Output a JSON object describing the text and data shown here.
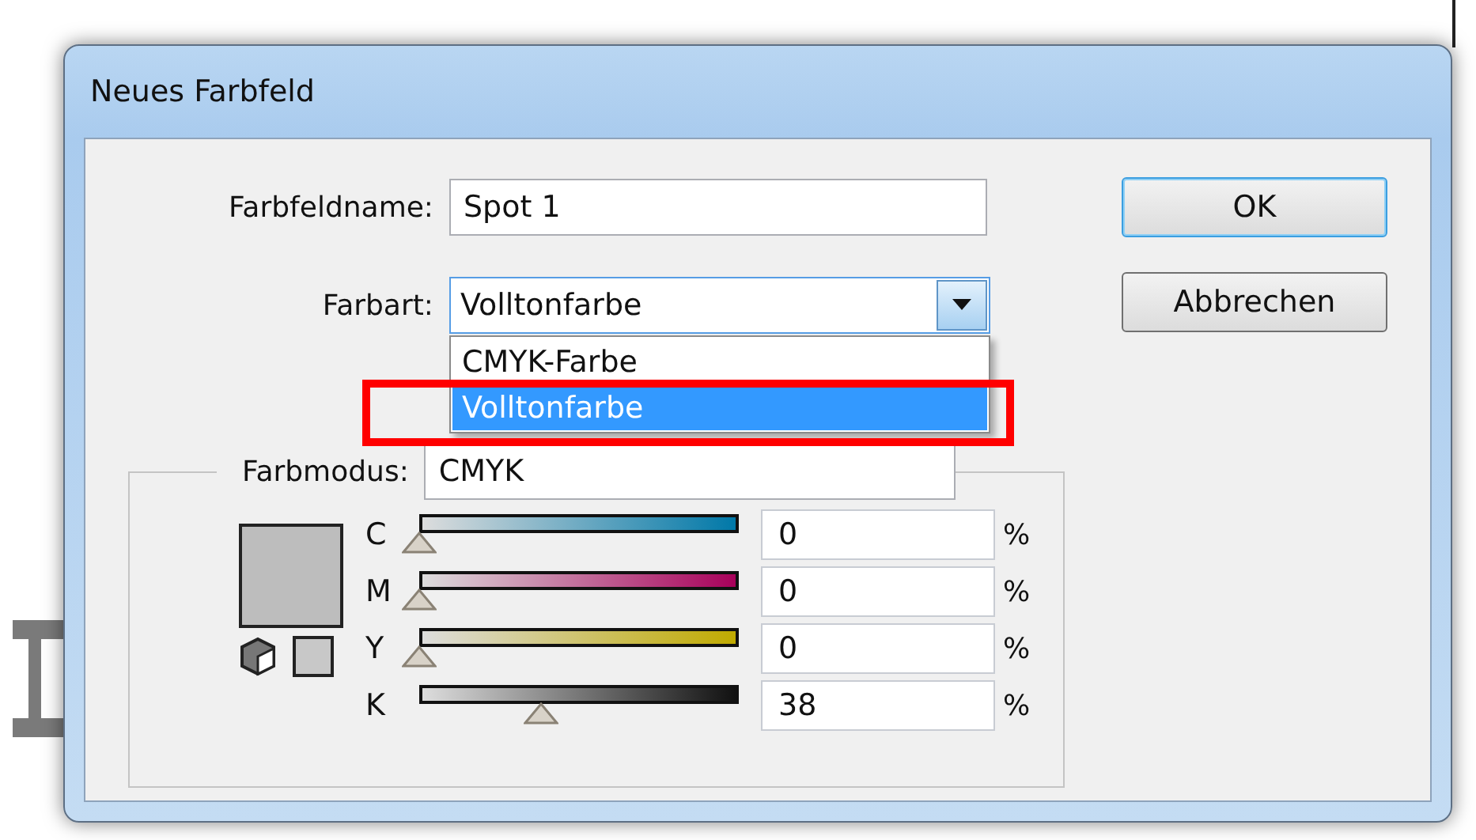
{
  "window": {
    "title": "Neues Farbfeld"
  },
  "name_field": {
    "label": "Farbfeldname:",
    "value": "Spot 1"
  },
  "color_type": {
    "label": "Farbart:",
    "value": "Volltonfarbe",
    "expanded": true,
    "options": [
      {
        "label": "CMYK-Farbe",
        "selected": false
      },
      {
        "label": "Volltonfarbe",
        "selected": true
      }
    ]
  },
  "color_mode": {
    "label": "Farbmodus:",
    "value": "CMYK"
  },
  "channels": [
    {
      "name": "C",
      "level": 0,
      "value": "0",
      "unit": "%",
      "color": "#0078a8"
    },
    {
      "name": "M",
      "level": 0,
      "value": "0",
      "unit": "%",
      "color": "#a8005a"
    },
    {
      "name": "Y",
      "level": 0,
      "value": "0",
      "unit": "%",
      "color": "#c0aa00"
    },
    {
      "name": "K",
      "level": 0.38,
      "value": "38",
      "unit": "%",
      "color": "#111111"
    }
  ],
  "buttons": [
    {
      "label": "OK",
      "default": true
    },
    {
      "label": "Abbrechen",
      "default": false
    }
  ],
  "annotation": {
    "kind": "frame"
  }
}
